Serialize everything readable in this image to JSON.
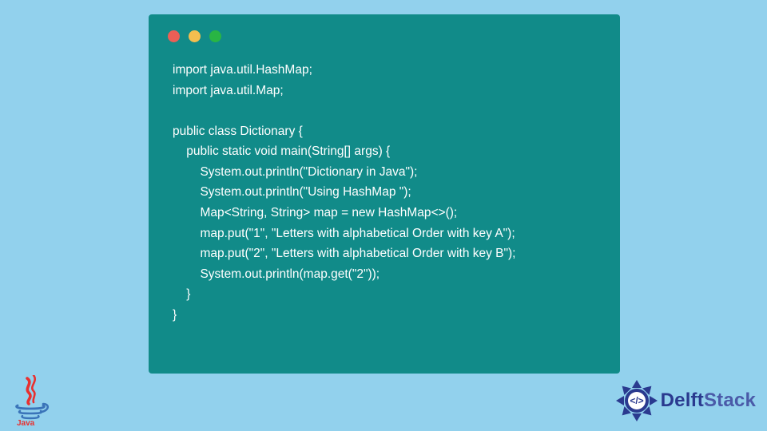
{
  "code": {
    "lines": [
      "import java.util.HashMap;",
      "import java.util.Map;",
      "",
      "public class Dictionary {",
      "    public static void main(String[] args) {",
      "        System.out.println(\"Dictionary in Java\");",
      "        System.out.println(\"Using HashMap \");",
      "        Map<String, String> map = new HashMap<>();",
      "        map.put(\"1\", \"Letters with alphabetical Order with key A\");",
      "        map.put(\"2\", \"Letters with alphabetical Order with key B\");",
      "        System.out.println(map.get(\"2\"));",
      "    }",
      "}"
    ]
  },
  "brand": {
    "name_main": "Delft",
    "name_suffix": "Stack",
    "accent": "#2a3a8f"
  },
  "java_logo": {
    "label": "Java"
  }
}
